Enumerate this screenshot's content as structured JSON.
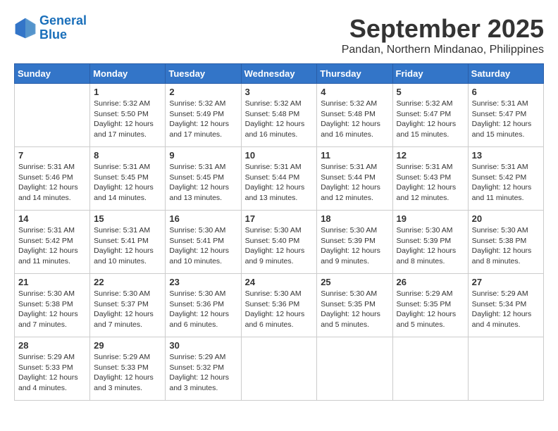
{
  "logo": {
    "line1": "General",
    "line2": "Blue"
  },
  "title": "September 2025",
  "location": "Pandan, Northern Mindanao, Philippines",
  "weekdays": [
    "Sunday",
    "Monday",
    "Tuesday",
    "Wednesday",
    "Thursday",
    "Friday",
    "Saturday"
  ],
  "weeks": [
    [
      {
        "day": "",
        "info": ""
      },
      {
        "day": "1",
        "info": "Sunrise: 5:32 AM\nSunset: 5:50 PM\nDaylight: 12 hours\nand 17 minutes."
      },
      {
        "day": "2",
        "info": "Sunrise: 5:32 AM\nSunset: 5:49 PM\nDaylight: 12 hours\nand 17 minutes."
      },
      {
        "day": "3",
        "info": "Sunrise: 5:32 AM\nSunset: 5:48 PM\nDaylight: 12 hours\nand 16 minutes."
      },
      {
        "day": "4",
        "info": "Sunrise: 5:32 AM\nSunset: 5:48 PM\nDaylight: 12 hours\nand 16 minutes."
      },
      {
        "day": "5",
        "info": "Sunrise: 5:32 AM\nSunset: 5:47 PM\nDaylight: 12 hours\nand 15 minutes."
      },
      {
        "day": "6",
        "info": "Sunrise: 5:31 AM\nSunset: 5:47 PM\nDaylight: 12 hours\nand 15 minutes."
      }
    ],
    [
      {
        "day": "7",
        "info": "Sunrise: 5:31 AM\nSunset: 5:46 PM\nDaylight: 12 hours\nand 14 minutes."
      },
      {
        "day": "8",
        "info": "Sunrise: 5:31 AM\nSunset: 5:45 PM\nDaylight: 12 hours\nand 14 minutes."
      },
      {
        "day": "9",
        "info": "Sunrise: 5:31 AM\nSunset: 5:45 PM\nDaylight: 12 hours\nand 13 minutes."
      },
      {
        "day": "10",
        "info": "Sunrise: 5:31 AM\nSunset: 5:44 PM\nDaylight: 12 hours\nand 13 minutes."
      },
      {
        "day": "11",
        "info": "Sunrise: 5:31 AM\nSunset: 5:44 PM\nDaylight: 12 hours\nand 12 minutes."
      },
      {
        "day": "12",
        "info": "Sunrise: 5:31 AM\nSunset: 5:43 PM\nDaylight: 12 hours\nand 12 minutes."
      },
      {
        "day": "13",
        "info": "Sunrise: 5:31 AM\nSunset: 5:42 PM\nDaylight: 12 hours\nand 11 minutes."
      }
    ],
    [
      {
        "day": "14",
        "info": "Sunrise: 5:31 AM\nSunset: 5:42 PM\nDaylight: 12 hours\nand 11 minutes."
      },
      {
        "day": "15",
        "info": "Sunrise: 5:31 AM\nSunset: 5:41 PM\nDaylight: 12 hours\nand 10 minutes."
      },
      {
        "day": "16",
        "info": "Sunrise: 5:30 AM\nSunset: 5:41 PM\nDaylight: 12 hours\nand 10 minutes."
      },
      {
        "day": "17",
        "info": "Sunrise: 5:30 AM\nSunset: 5:40 PM\nDaylight: 12 hours\nand 9 minutes."
      },
      {
        "day": "18",
        "info": "Sunrise: 5:30 AM\nSunset: 5:39 PM\nDaylight: 12 hours\nand 9 minutes."
      },
      {
        "day": "19",
        "info": "Sunrise: 5:30 AM\nSunset: 5:39 PM\nDaylight: 12 hours\nand 8 minutes."
      },
      {
        "day": "20",
        "info": "Sunrise: 5:30 AM\nSunset: 5:38 PM\nDaylight: 12 hours\nand 8 minutes."
      }
    ],
    [
      {
        "day": "21",
        "info": "Sunrise: 5:30 AM\nSunset: 5:38 PM\nDaylight: 12 hours\nand 7 minutes."
      },
      {
        "day": "22",
        "info": "Sunrise: 5:30 AM\nSunset: 5:37 PM\nDaylight: 12 hours\nand 7 minutes."
      },
      {
        "day": "23",
        "info": "Sunrise: 5:30 AM\nSunset: 5:36 PM\nDaylight: 12 hours\nand 6 minutes."
      },
      {
        "day": "24",
        "info": "Sunrise: 5:30 AM\nSunset: 5:36 PM\nDaylight: 12 hours\nand 6 minutes."
      },
      {
        "day": "25",
        "info": "Sunrise: 5:30 AM\nSunset: 5:35 PM\nDaylight: 12 hours\nand 5 minutes."
      },
      {
        "day": "26",
        "info": "Sunrise: 5:29 AM\nSunset: 5:35 PM\nDaylight: 12 hours\nand 5 minutes."
      },
      {
        "day": "27",
        "info": "Sunrise: 5:29 AM\nSunset: 5:34 PM\nDaylight: 12 hours\nand 4 minutes."
      }
    ],
    [
      {
        "day": "28",
        "info": "Sunrise: 5:29 AM\nSunset: 5:33 PM\nDaylight: 12 hours\nand 4 minutes."
      },
      {
        "day": "29",
        "info": "Sunrise: 5:29 AM\nSunset: 5:33 PM\nDaylight: 12 hours\nand 3 minutes."
      },
      {
        "day": "30",
        "info": "Sunrise: 5:29 AM\nSunset: 5:32 PM\nDaylight: 12 hours\nand 3 minutes."
      },
      {
        "day": "",
        "info": ""
      },
      {
        "day": "",
        "info": ""
      },
      {
        "day": "",
        "info": ""
      },
      {
        "day": "",
        "info": ""
      }
    ]
  ]
}
